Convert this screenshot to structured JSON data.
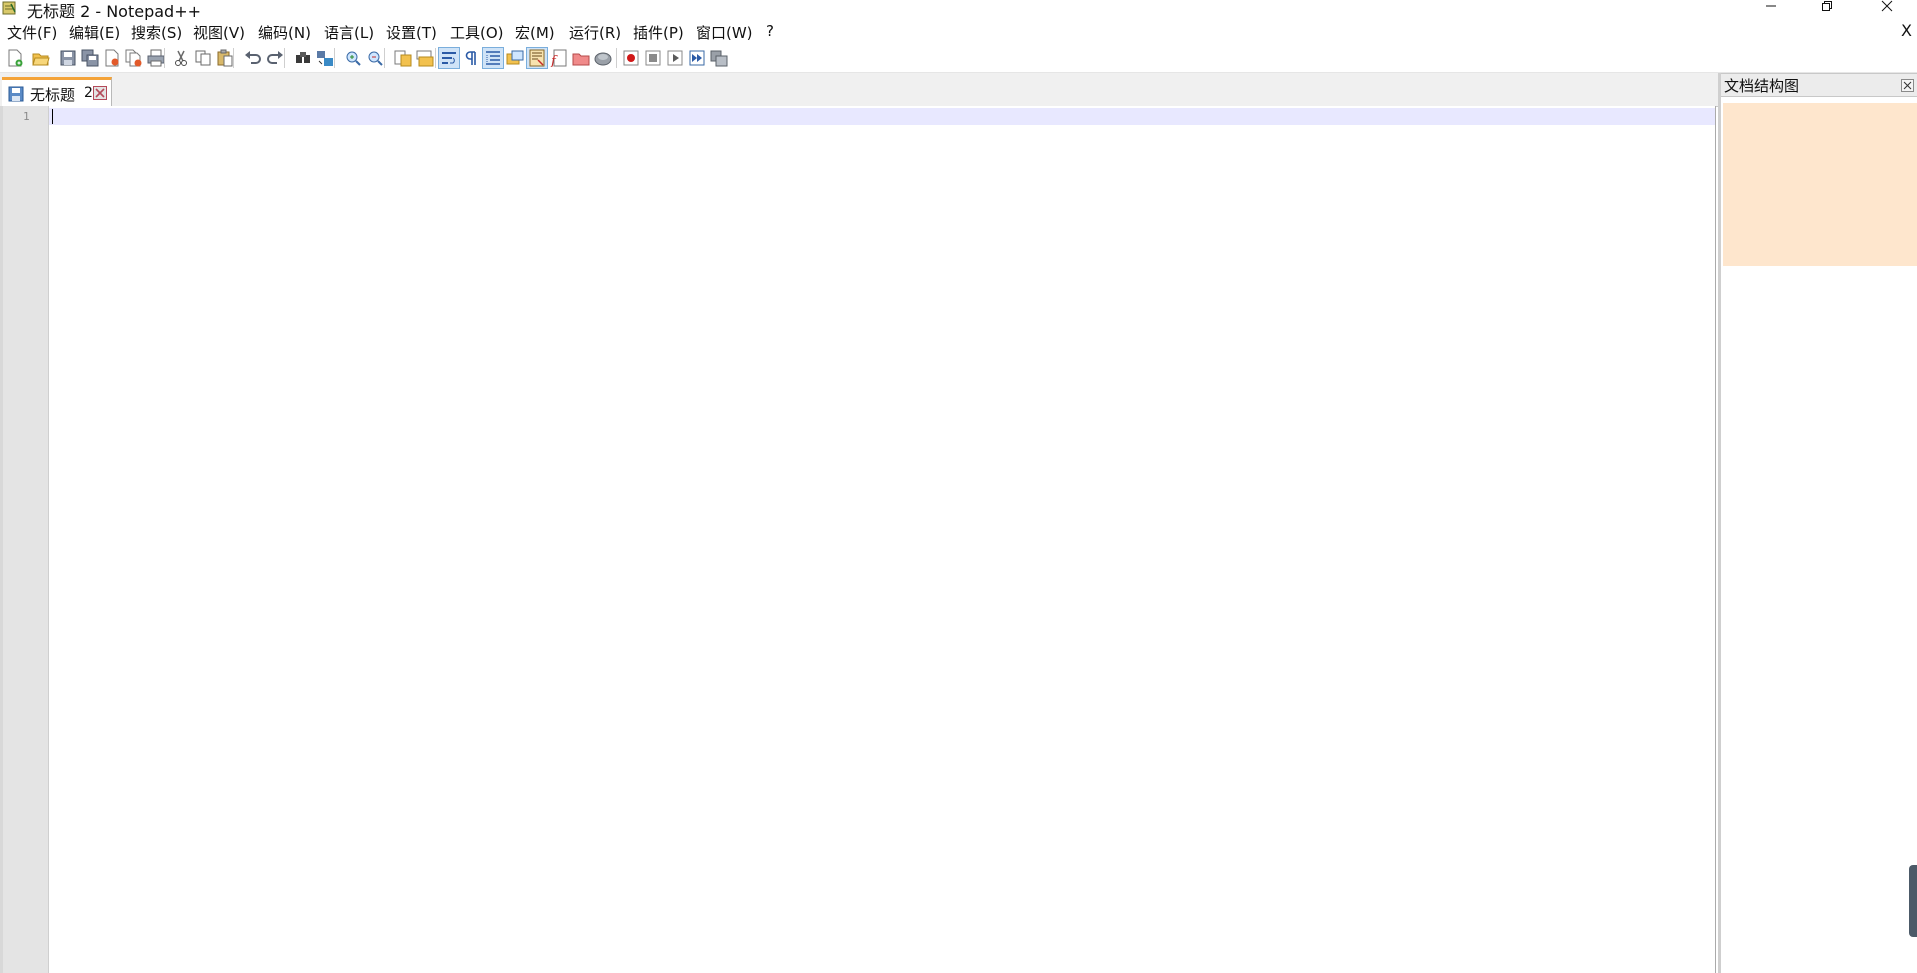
{
  "window": {
    "title": "无标题 2 - Notepad++"
  },
  "menu": {
    "items": [
      "文件(F)",
      "编辑(E)",
      "搜索(S)",
      "视图(V)",
      "编码(N)",
      "语言(L)",
      "设置(T)",
      "工具(O)",
      "宏(M)",
      "运行(R)",
      "插件(P)",
      "窗口(W)",
      "?"
    ],
    "close_label": "X"
  },
  "toolbar": {
    "buttons": [
      {
        "name": "new-file",
        "icon": "new-file-icon"
      },
      {
        "name": "open-file",
        "icon": "open-folder-icon"
      },
      {
        "name": "save",
        "icon": "save-icon"
      },
      {
        "name": "save-all",
        "icon": "save-all-icon"
      },
      {
        "name": "close",
        "icon": "close-file-icon"
      },
      {
        "name": "close-all",
        "icon": "close-all-icon"
      },
      {
        "name": "print",
        "icon": "print-icon"
      },
      {
        "name": "cut",
        "icon": "cut-icon"
      },
      {
        "name": "copy",
        "icon": "copy-icon"
      },
      {
        "name": "paste",
        "icon": "paste-icon"
      },
      {
        "name": "undo",
        "icon": "undo-icon"
      },
      {
        "name": "redo",
        "icon": "redo-icon"
      },
      {
        "name": "find",
        "icon": "find-icon"
      },
      {
        "name": "replace",
        "icon": "replace-icon"
      },
      {
        "name": "zoom-in",
        "icon": "zoom-in-icon"
      },
      {
        "name": "zoom-out",
        "icon": "zoom-out-icon"
      },
      {
        "name": "sync-vertical",
        "icon": "sync-vertical-icon"
      },
      {
        "name": "sync-horizontal",
        "icon": "sync-horizontal-icon"
      },
      {
        "name": "word-wrap",
        "icon": "word-wrap-icon"
      },
      {
        "name": "show-all-chars",
        "icon": "pilcrow-icon"
      },
      {
        "name": "indent-guide",
        "icon": "indent-guide-icon"
      },
      {
        "name": "user-language",
        "icon": "user-language-icon"
      },
      {
        "name": "document-map",
        "icon": "document-map-icon"
      },
      {
        "name": "function-list",
        "icon": "function-list-icon"
      },
      {
        "name": "folder-as-workspace",
        "icon": "folder-workspace-icon"
      },
      {
        "name": "monitoring",
        "icon": "monitoring-icon"
      },
      {
        "name": "record-macro",
        "icon": "record-icon"
      },
      {
        "name": "stop-macro",
        "icon": "stop-icon"
      },
      {
        "name": "play-macro",
        "icon": "play-icon"
      },
      {
        "name": "run-macro-multiple",
        "icon": "fast-forward-icon"
      },
      {
        "name": "save-macro",
        "icon": "save-macro-icon"
      }
    ],
    "active": [
      "word-wrap",
      "indent-guide",
      "document-map"
    ]
  },
  "tabs": [
    {
      "label": "无标题",
      "number": "2",
      "active": true
    }
  ],
  "editor": {
    "line_numbers": [
      "1"
    ],
    "content": ""
  },
  "docmap": {
    "title": "文档结构图"
  },
  "colors": {
    "tab_accent": "#f4a339",
    "current_line": "#e8e8ff",
    "docmap_view": "#fee6cd",
    "gutter": "#e4e4e4"
  }
}
